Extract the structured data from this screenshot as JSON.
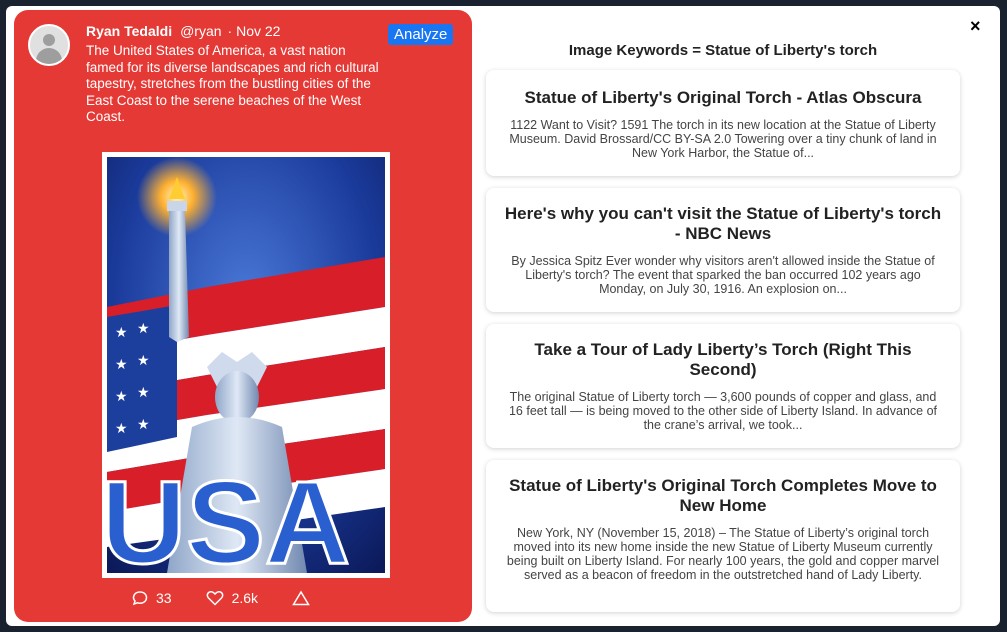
{
  "tweet": {
    "name": "Ryan Tedaldi",
    "handle": "@ryan",
    "date": "· Nov 22",
    "text": "The United States of America, a vast nation famed for its diverse landscapes and rich cultural tapestry, stretches from the bustling cities of the East Coast to the serene beaches of the West Coast.",
    "analyze_label": "Analyze",
    "comments": "33",
    "likes": "2.6k"
  },
  "panel": {
    "title": "Image Keywords = Statue of Liberty's torch",
    "close_label": "×",
    "results": [
      {
        "title": "Statue of Liberty's Original Torch - Atlas Obscura",
        "snippet": "1122 Want to Visit? 1591 The torch in its new location at the Statue of Liberty Museum. David Brossard/CC BY-SA 2.0 Towering over a tiny chunk of land in New York Harbor, the Statue of..."
      },
      {
        "title": "Here's why you can't visit the Statue of Liberty's torch - NBC News",
        "snippet": "By Jessica Spitz Ever wonder why visitors aren't allowed inside the Statue of Liberty's torch? The event that sparked the ban occurred 102 years ago Monday, on July 30, 1916. An explosion on..."
      },
      {
        "title": "Take a Tour of Lady Liberty’s Torch (Right This Second)",
        "snippet": "The original Statue of Liberty torch — 3,600 pounds of copper and glass, and 16 feet tall — is being moved to the other side of Liberty Island. In advance of the crane’s arrival, we took..."
      },
      {
        "title": "Statue of Liberty's Original Torch Completes Move to New Home",
        "snippet": "New York, NY (November 15, 2018) – The Statue of Liberty’s original torch moved into its new home inside the new Statue of Liberty Museum currently being built on Liberty Island. For nearly 100 years, the gold and copper marvel served as a beacon of freedom in the outstretched hand of Lady Liberty."
      }
    ]
  },
  "colors": {
    "tweet_bg": "#e53935",
    "analyze_bg": "#1976f2"
  },
  "image_text": "USA"
}
